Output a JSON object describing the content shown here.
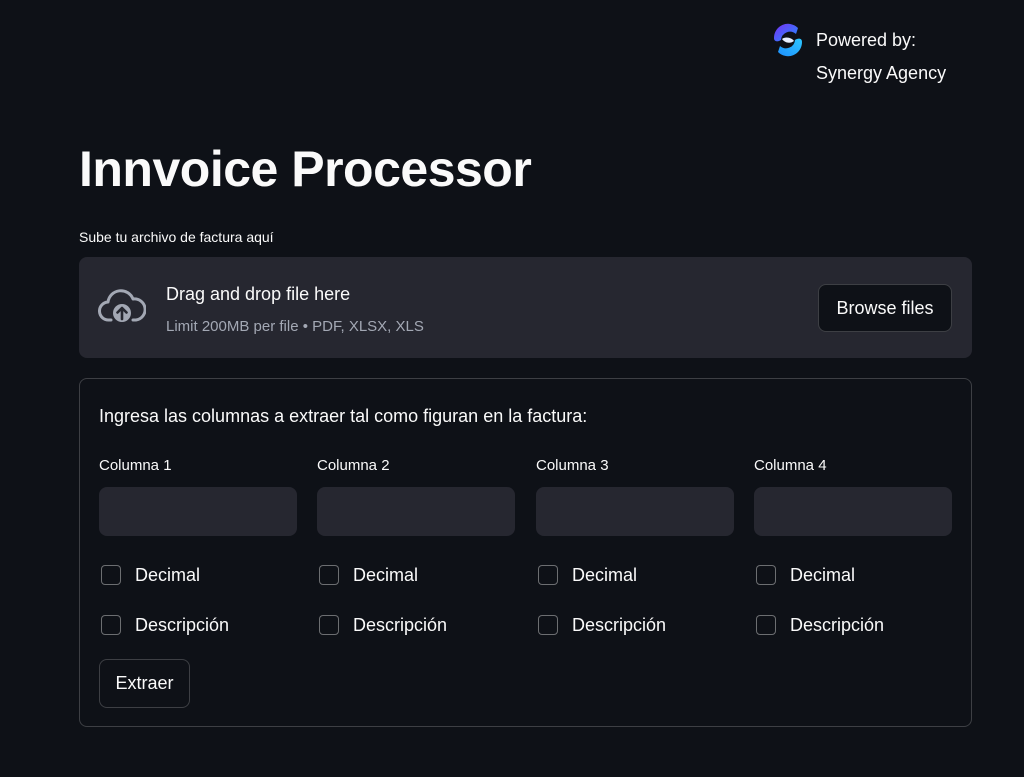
{
  "branding": {
    "line1": "Powered by:",
    "line2": "Synergy Agency",
    "logo_icon": "synergy-logo-icon",
    "logo_colors": [
      "#7a2ff5",
      "#1e90ff",
      "#2dc7ff"
    ]
  },
  "title": "Innvoice Processor",
  "uploader": {
    "label": "Sube tu archivo de factura aquí",
    "drop_title": "Drag and drop file here",
    "limit_text": "Limit 200MB per file • PDF, XLSX, XLS",
    "browse_label": "Browse files",
    "icon": "cloud-upload-icon"
  },
  "form": {
    "instruction": "Ingresa las columnas a extraer tal como figuran en la factura:",
    "columns": [
      {
        "label": "Columna 1",
        "value": "",
        "decimal_label": "Decimal",
        "decimal_checked": false,
        "description_label": "Descripción",
        "description_checked": false
      },
      {
        "label": "Columna 2",
        "value": "",
        "decimal_label": "Decimal",
        "decimal_checked": false,
        "description_label": "Descripción",
        "description_checked": false
      },
      {
        "label": "Columna 3",
        "value": "",
        "decimal_label": "Decimal",
        "decimal_checked": false,
        "description_label": "Descripción",
        "description_checked": false
      },
      {
        "label": "Columna 4",
        "value": "",
        "decimal_label": "Decimal",
        "decimal_checked": false,
        "description_label": "Descripción",
        "description_checked": false
      }
    ],
    "submit_label": "Extraer"
  },
  "colors": {
    "background": "#0e1117",
    "surface": "#262730",
    "text": "#fafafa",
    "muted_text": "#a3a8b4"
  }
}
